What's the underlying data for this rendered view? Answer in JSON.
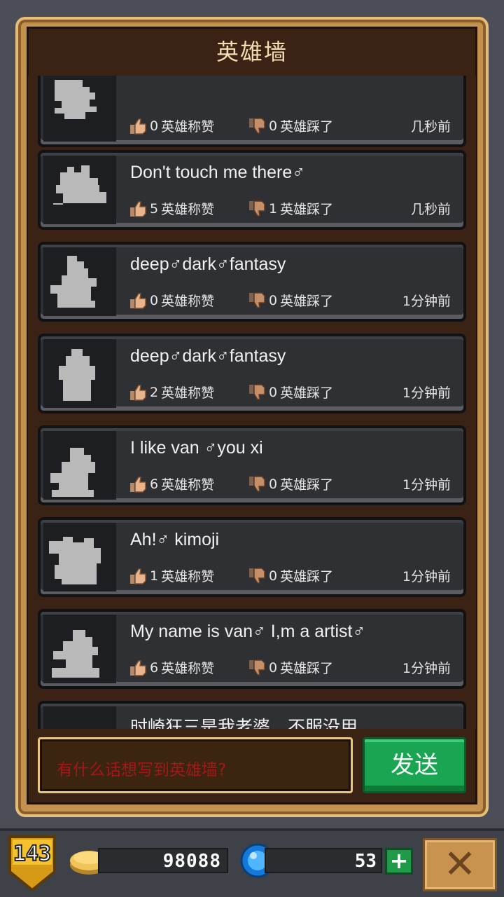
{
  "header": {
    "title": "英雄墙"
  },
  "posts": [
    {
      "message": "",
      "likes": "0",
      "like_label": "英雄称赞",
      "dislikes": "0",
      "dislike_label": "英雄踩了",
      "time": "几秒前"
    },
    {
      "message": "Don't touch me there♂",
      "likes": "5",
      "like_label": "英雄称赞",
      "dislikes": "1",
      "dislike_label": "英雄踩了",
      "time": "几秒前"
    },
    {
      "message": "deep♂dark♂fantasy",
      "likes": "0",
      "like_label": "英雄称赞",
      "dislikes": "0",
      "dislike_label": "英雄踩了",
      "time": "1分钟前"
    },
    {
      "message": "deep♂dark♂fantasy",
      "likes": "2",
      "like_label": "英雄称赞",
      "dislikes": "0",
      "dislike_label": "英雄踩了",
      "time": "1分钟前"
    },
    {
      "message": "I like van ♂you xi",
      "likes": "6",
      "like_label": "英雄称赞",
      "dislikes": "0",
      "dislike_label": "英雄踩了",
      "time": "1分钟前"
    },
    {
      "message": "Ah!♂  kimoji",
      "likes": "1",
      "like_label": "英雄称赞",
      "dislikes": "0",
      "dislike_label": "英雄踩了",
      "time": "1分钟前"
    },
    {
      "message": "My name is van♂ I,m a artist♂",
      "likes": "6",
      "like_label": "英雄称赞",
      "dislikes": "0",
      "dislike_label": "英雄踩了",
      "time": "1分钟前"
    },
    {
      "message": "时崎狂三是我老婆，不服没用",
      "likes": "",
      "like_label": "",
      "dislikes": "",
      "dislike_label": "",
      "time": ""
    }
  ],
  "composer": {
    "placeholder": "有什么话想写到英雄墙?",
    "send_label": "发送"
  },
  "footer": {
    "level": "143",
    "gold": "98088",
    "gems": "53",
    "plus_label": "+",
    "close_label": "✕"
  },
  "colors": {
    "accent_green": "#19a552",
    "frame": "#c4924f",
    "placeholder_red": "#a31818"
  },
  "icons": {
    "like": "thumbs-up-icon",
    "dislike": "thumbs-down-icon",
    "gold": "coin-icon",
    "gem": "blue-gem-icon",
    "level": "shield-badge-icon",
    "close": "close-icon"
  }
}
